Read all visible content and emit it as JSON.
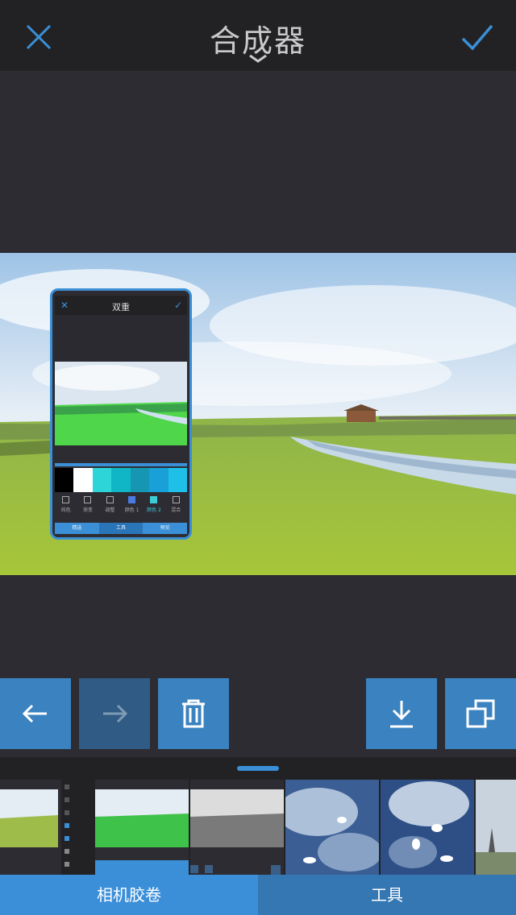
{
  "header": {
    "title": "合成器",
    "close_icon": "close-icon",
    "confirm_icon": "checkmark-icon",
    "dropdown_icon": "chevron-down-icon"
  },
  "overlay_preview": {
    "title": "双重",
    "swatches": [
      "#000000",
      "#ffffff",
      "#2dd4d8",
      "#10b6c6",
      "#1696b2",
      "#1aa0d8",
      "#1ec0e8"
    ],
    "tools": [
      "纯色",
      "渐变",
      "调整",
      "颜色 1",
      "颜色 2",
      "混合"
    ],
    "tabs": [
      "精选",
      "工具",
      "预览"
    ]
  },
  "toolbar": {
    "undo_icon": "arrow-left-icon",
    "redo_icon": "arrow-right-icon",
    "delete_icon": "trash-icon",
    "download_icon": "download-icon",
    "duplicate_icon": "duplicate-icon"
  },
  "bottom_tabs": {
    "camera_roll": "相机胶卷",
    "tools": "工具"
  },
  "colors": {
    "accent": "#3a8fd6",
    "button_bg": "#3a82c0",
    "topbar_bg": "#222225",
    "canvas_bg": "#2d2c32"
  }
}
